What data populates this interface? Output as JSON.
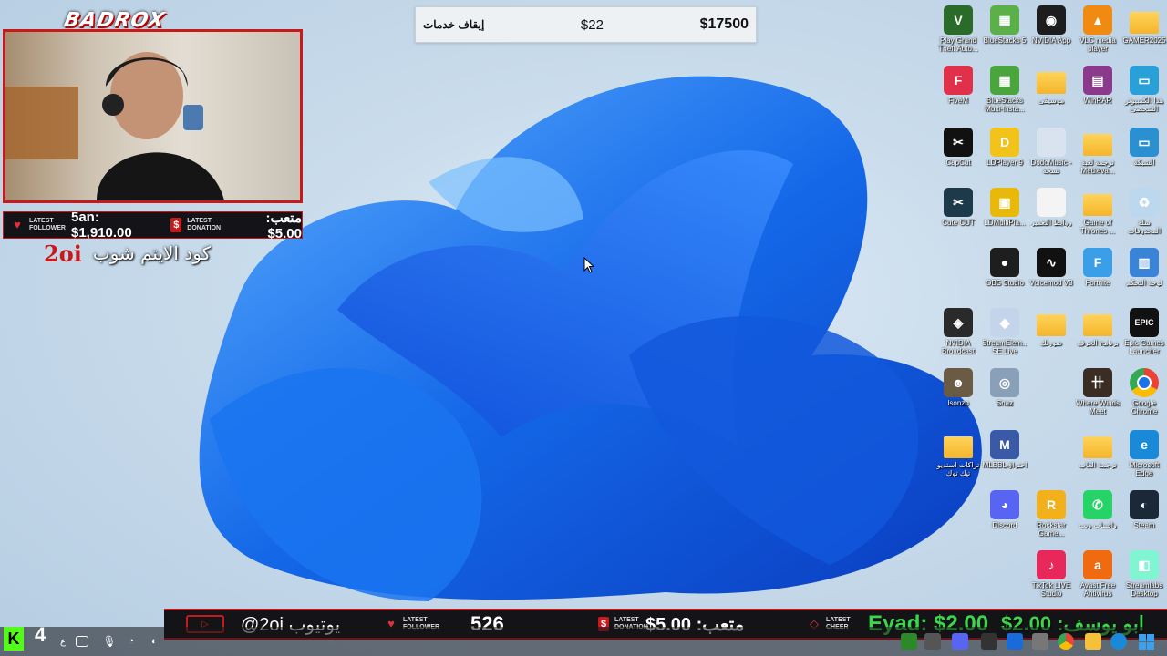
{
  "topbar": {
    "action": "إيقاف خدمات",
    "price": "$22",
    "total": "$17500"
  },
  "overlay": {
    "brand": "BADROX",
    "follower_caption": [
      "LATEST",
      "FOLLOWER"
    ],
    "follower_value": "5an: $1,910.00",
    "donation_caption": [
      "LATEST",
      "DONATION"
    ],
    "donation_value": "متعب: 5.00$",
    "dollar_sign": "$",
    "shop_code": "2oi",
    "shop_label": "كود الايتم شوب"
  },
  "desktop_icons": [
    {
      "label": "Play Grand Theft Auto...",
      "icon": "gta-icon",
      "color": "#2a6b2a",
      "glyph": "V",
      "col": 0,
      "row": 0
    },
    {
      "label": "BlueStacks 5",
      "icon": "bluestacks-icon",
      "color": "#5bb04a",
      "glyph": "▦",
      "col": 1,
      "row": 0
    },
    {
      "label": "NVIDIA App",
      "icon": "nvidia-icon",
      "color": "#1d1d1d",
      "glyph": "◉",
      "col": 2,
      "row": 0
    },
    {
      "label": "VLC media player",
      "icon": "vlc-icon",
      "color": "#f08a10",
      "glyph": "▲",
      "col": 3,
      "row": 0
    },
    {
      "label": "GAMER2025",
      "icon": "folder-icon",
      "color": "folder",
      "glyph": "",
      "col": 4,
      "row": 0
    },
    {
      "label": "FiveM",
      "icon": "fivem-icon",
      "color": "#e0304a",
      "glyph": "F",
      "col": 0,
      "row": 1
    },
    {
      "label": "BlueStacks Multi-Insta...",
      "icon": "bluestacks-multi-icon",
      "color": "#4aa63c",
      "glyph": "▦",
      "col": 1,
      "row": 1
    },
    {
      "label": "موسيقى",
      "icon": "folder-icon",
      "color": "folder",
      "glyph": "",
      "col": 2,
      "row": 1
    },
    {
      "label": "WinRAR",
      "icon": "winrar-icon",
      "color": "#8b3a8b",
      "glyph": "▤",
      "col": 3,
      "row": 1
    },
    {
      "label": "هذا الكمبيوتر الشخصي",
      "icon": "this-pc-icon",
      "color": "#2aa0d8",
      "glyph": "▭",
      "col": 4,
      "row": 1
    },
    {
      "label": "CapCut",
      "icon": "capcut-icon",
      "color": "#111",
      "glyph": "✂",
      "col": 0,
      "row": 2
    },
    {
      "label": "LDPlayer 9",
      "icon": "ldplayer-icon",
      "color": "#f2c31a",
      "glyph": "D",
      "col": 1,
      "row": 2
    },
    {
      "label": "DodoMusic - نسخة",
      "icon": "doc-icon",
      "color": "#d9e3ef",
      "glyph": "",
      "col": 2,
      "row": 2
    },
    {
      "label": "ترجمة لعبة Medieva...",
      "icon": "folder-icon",
      "color": "folder",
      "glyph": "",
      "col": 3,
      "row": 2
    },
    {
      "label": "الشبكة",
      "icon": "network-icon",
      "color": "#2a90d0",
      "glyph": "▭",
      "col": 4,
      "row": 2
    },
    {
      "label": "Cute CUT",
      "icon": "cutecut-icon",
      "color": "#1c3a4a",
      "glyph": "✂",
      "col": 0,
      "row": 3
    },
    {
      "label": "LDMultiPla...",
      "icon": "ldmulti-icon",
      "color": "#e8b80a",
      "glyph": "▣",
      "col": 1,
      "row": 3
    },
    {
      "label": "روابط التعمير",
      "icon": "file-icon",
      "color": "#f4f4f4",
      "glyph": "",
      "col": 2,
      "row": 3
    },
    {
      "label": "Game of Thrones ...",
      "icon": "folder-icon",
      "color": "folder",
      "glyph": "",
      "col": 3,
      "row": 3
    },
    {
      "label": "سلة المحذوفات",
      "icon": "recycle-bin-icon",
      "color": "#bcd8ee",
      "glyph": "♻",
      "col": 4,
      "row": 3
    },
    {
      "label": "OBS Studio",
      "icon": "obs-icon",
      "color": "#1e1e1e",
      "glyph": "●",
      "col": 1,
      "row": 4
    },
    {
      "label": "Voicemod V3",
      "icon": "voicemod-icon",
      "color": "#111",
      "glyph": "∿",
      "col": 2,
      "row": 4
    },
    {
      "label": "Fortnite",
      "icon": "fortnite-icon",
      "color": "#3b9ee8",
      "glyph": "F",
      "col": 3,
      "row": 4
    },
    {
      "label": "لوحة التحكم",
      "icon": "control-panel-icon",
      "color": "#3a84d8",
      "glyph": "▥",
      "col": 4,
      "row": 4
    },
    {
      "label": "NVIDIA Broadcast",
      "icon": "nvidia-broadcast-icon",
      "color": "#2a2a2a",
      "glyph": "◈",
      "col": 0,
      "row": 5
    },
    {
      "label": "StreamElem... SE.Live",
      "icon": "streamelements-icon",
      "color": "#c4d4ea",
      "glyph": "◆",
      "col": 1,
      "row": 5
    },
    {
      "label": "صورتك",
      "icon": "folder-icon",
      "color": "folder",
      "glyph": "",
      "col": 2,
      "row": 5
    },
    {
      "label": "برنامج الحرف",
      "icon": "folder-icon",
      "color": "folder",
      "glyph": "",
      "col": 3,
      "row": 5
    },
    {
      "label": "Epic Games Launcher",
      "icon": "epic-games-icon",
      "color": "#111",
      "glyph": "EPIC",
      "col": 4,
      "row": 5
    },
    {
      "label": "Isonzo",
      "icon": "isonzo-icon",
      "color": "#6b5a44",
      "glyph": "☻",
      "col": 0,
      "row": 6
    },
    {
      "label": "Snaz",
      "icon": "snaz-icon",
      "color": "#8aa0b8",
      "glyph": "◎",
      "col": 1,
      "row": 6
    },
    {
      "label": "Where Winds Meet",
      "icon": "where-winds-meet-icon",
      "color": "#3a2e24",
      "glyph": "卄",
      "col": 3,
      "row": 6
    },
    {
      "label": "Google Chrome",
      "icon": "chrome-icon",
      "color": "chrome",
      "glyph": "",
      "col": 4,
      "row": 6
    },
    {
      "label": "تراكات استديو تيك توك",
      "icon": "folder-icon",
      "color": "folder",
      "glyph": "",
      "col": 0,
      "row": 7
    },
    {
      "label": "MLBBLاختراق",
      "icon": "mlbb-icon",
      "color": "#3a5aa8",
      "glyph": "M",
      "col": 1,
      "row": 7
    },
    {
      "label": "ترجمة الغاب",
      "icon": "folder-icon",
      "color": "folder",
      "glyph": "",
      "col": 3,
      "row": 7
    },
    {
      "label": "Microsoft Edge",
      "icon": "edge-icon",
      "color": "#1a8ad8",
      "glyph": "e",
      "col": 4,
      "row": 7
    },
    {
      "label": "Discord",
      "icon": "discord-icon",
      "color": "#5865f2",
      "glyph": "◕",
      "col": 1,
      "row": 8
    },
    {
      "label": "Rockstar Game...",
      "icon": "rockstar-icon",
      "color": "#f2b01a",
      "glyph": "R",
      "col": 2,
      "row": 8
    },
    {
      "label": "واتساب ويب",
      "icon": "whatsapp-icon",
      "color": "#25d366",
      "glyph": "✆",
      "col": 3,
      "row": 8
    },
    {
      "label": "Steam",
      "icon": "steam-icon",
      "color": "#1b2838",
      "glyph": "◐",
      "col": 4,
      "row": 8
    },
    {
      "label": "TikTok LIVE Studio",
      "icon": "tiktok-icon",
      "color": "#e8285a",
      "glyph": "♪",
      "col": 2,
      "row": 9
    },
    {
      "label": "Avast Free Antivirus",
      "icon": "avast-icon",
      "color": "#f06a10",
      "glyph": "a",
      "col": 3,
      "row": 9
    },
    {
      "label": "Streamlabs Desktop",
      "icon": "streamlabs-icon",
      "color": "#80f5d2",
      "glyph": "◧",
      "col": 4,
      "row": 9
    }
  ],
  "bottom": {
    "youtube_handle": "@2oi يوتيوب",
    "follower_caption": [
      "LATEST",
      "FOLLOWER"
    ],
    "follower_count": "526",
    "donation_caption": [
      "LATEST",
      "DONATION"
    ],
    "donation_value": "متعب: 5.00$",
    "cheer_caption": [
      "LATEST",
      "CHEER"
    ],
    "cheer_value": "Eyad: $2.00",
    "ticker": "ابو يوسف: 2.00$",
    "dollar_sign": "$"
  },
  "taskbar": {
    "kick_letter": "K",
    "kick_count": "4"
  }
}
